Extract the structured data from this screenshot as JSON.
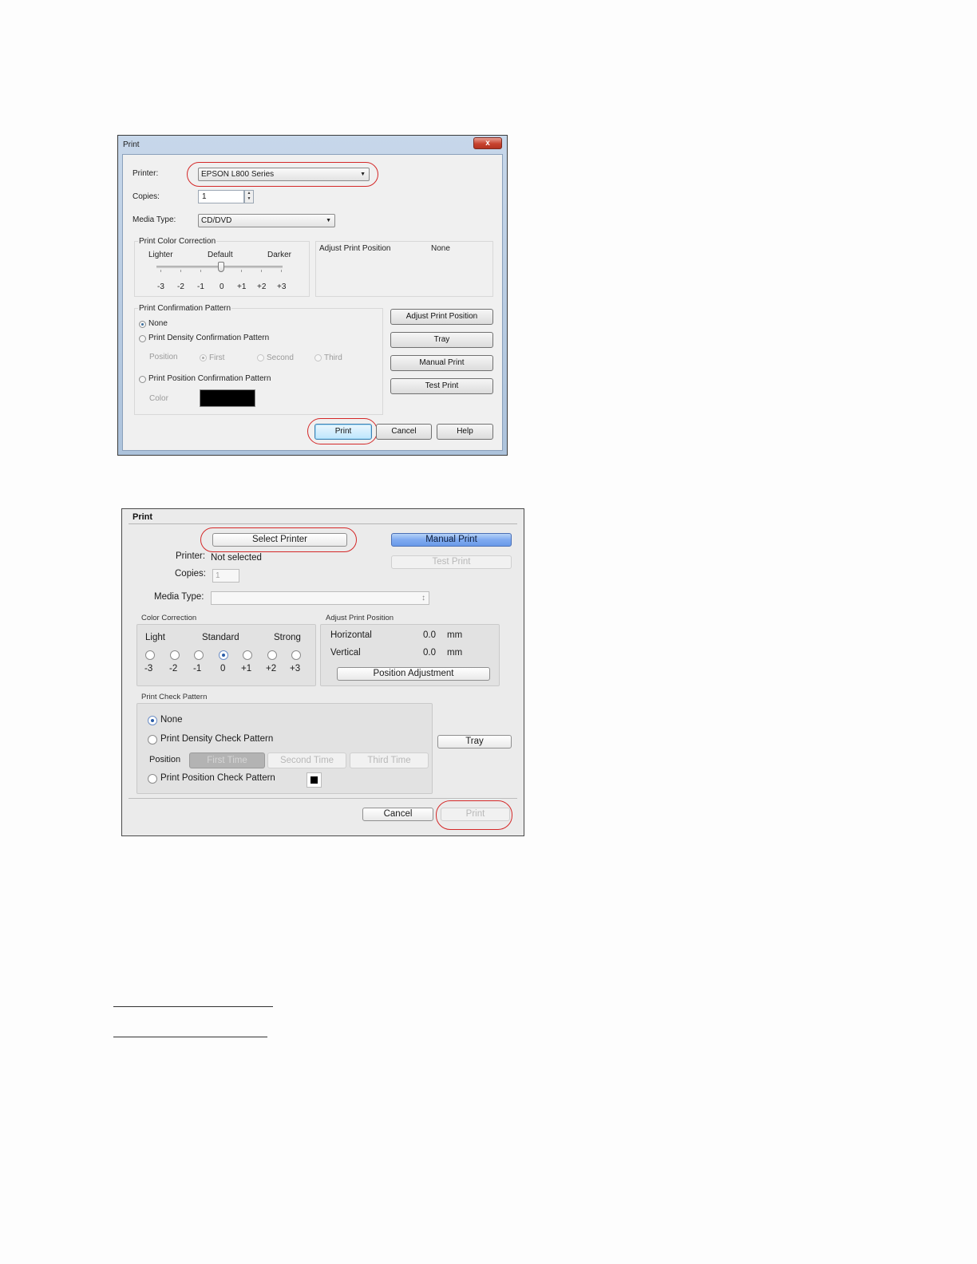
{
  "windows_dialog": {
    "title": "Print",
    "close_label": "x",
    "printer_label": "Printer:",
    "printer_value": "EPSON L800 Series",
    "copies_label": "Copies:",
    "copies_value": "1",
    "media_type_label": "Media Type:",
    "media_type_value": "CD/DVD",
    "color_correction": {
      "title": "Print Color Correction",
      "lighter": "Lighter",
      "default": "Default",
      "darker": "Darker",
      "scale": [
        "-3",
        "-2",
        "-1",
        "0",
        "+1",
        "+2",
        "+3"
      ],
      "value": "0"
    },
    "adjust_position": {
      "label": "Adjust Print Position",
      "value": "None"
    },
    "confirmation": {
      "title": "Print Confirmation Pattern",
      "none": "None",
      "density": "Print Density Confirmation Pattern",
      "position_label": "Position",
      "first": "First",
      "second": "Second",
      "third": "Third",
      "position_pattern": "Print Position Confirmation Pattern",
      "color_label": "Color"
    },
    "buttons": {
      "adjust_print_position": "Adjust Print Position",
      "tray": "Tray",
      "manual_print": "Manual Print",
      "test_print": "Test Print",
      "print": "Print",
      "cancel": "Cancel",
      "help": "Help"
    }
  },
  "mac_dialog": {
    "title": "Print",
    "select_printer": "Select Printer",
    "manual_print": "Manual Print",
    "test_print": "Test Print",
    "printer_label": "Printer:",
    "printer_value": "Not selected",
    "copies_label": "Copies:",
    "copies_value": "1",
    "media_type_label": "Media Type:",
    "media_type_arrow": "↕",
    "color_correction": {
      "title": "Color Correction",
      "light": "Light",
      "standard": "Standard",
      "strong": "Strong",
      "scale": [
        "-3",
        "-2",
        "-1",
        "0",
        "+1",
        "+2",
        "+3"
      ],
      "selected": "0"
    },
    "adjust_position": {
      "title": "Adjust Print Position",
      "horizontal_label": "Horizontal",
      "horizontal_value": "0.0",
      "vertical_label": "Vertical",
      "vertical_value": "0.0",
      "unit": "mm",
      "position_adjustment": "Position Adjustment"
    },
    "check_pattern": {
      "title": "Print Check Pattern",
      "none": "None",
      "density": "Print Density Check Pattern",
      "position_label": "Position",
      "first_time": "First Time",
      "second_time": "Second Time",
      "third_time": "Third Time",
      "position_pattern": "Print Position Check Pattern"
    },
    "tray": "Tray",
    "cancel": "Cancel",
    "print": "Print"
  },
  "colors": {
    "highlight_oval": "#d42828",
    "mac_blue": "#7faaf0",
    "swatch": "#000000"
  }
}
